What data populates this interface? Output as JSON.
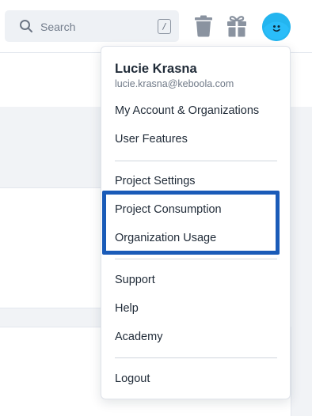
{
  "header": {
    "search": {
      "placeholder": "Search",
      "shortcut": "/"
    },
    "icons": [
      "search-icon",
      "trash-icon",
      "gift-icon",
      "avatar"
    ]
  },
  "menu": {
    "user_name": "Lucie Krasna",
    "user_email": "lucie.krasna@keboola.com",
    "group1": [
      "My Account & Organizations",
      "User Features"
    ],
    "group2": [
      "Project Settings",
      "Project Consumption",
      "Organization Usage"
    ],
    "group3": [
      "Support",
      "Help",
      "Academy"
    ],
    "group4": [
      "Logout"
    ]
  },
  "colors": {
    "highlight": "#1a5bb8",
    "avatar": "#24b5ef",
    "search_bg": "#eef1f5"
  }
}
